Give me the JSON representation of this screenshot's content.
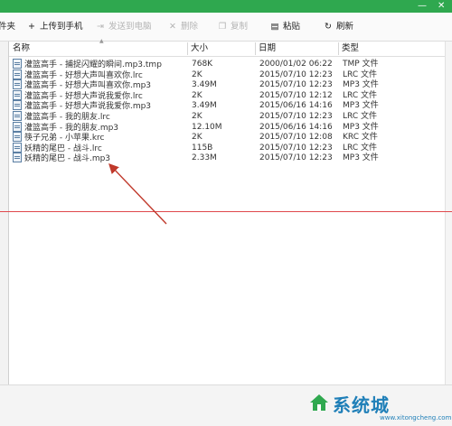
{
  "toolbar": {
    "items": [
      {
        "label": "件夹",
        "icon": "folder-icon",
        "enabled": true
      },
      {
        "label": "上传到手机",
        "icon": "plus-icon",
        "enabled": true
      },
      {
        "label": "发送到电脑",
        "icon": "send-to-pc-icon",
        "enabled": false
      },
      {
        "label": "删除",
        "icon": "delete-icon",
        "enabled": false
      },
      {
        "label": "复制",
        "icon": "copy-icon",
        "enabled": false
      },
      {
        "label": "粘贴",
        "icon": "paste-icon",
        "enabled": true
      },
      {
        "label": "刷新",
        "icon": "refresh-icon",
        "enabled": true
      }
    ]
  },
  "window_controls": {
    "minimize": "—",
    "close": "✕"
  },
  "table": {
    "columns": [
      "名称",
      "大小",
      "日期",
      "类型"
    ],
    "rows": [
      {
        "name": "灌篮高手 - 捕捉闪耀的瞬间.mp3.tmp",
        "size": "768K",
        "date": "2000/01/02 06:22",
        "type": "TMP 文件"
      },
      {
        "name": "灌篮高手 - 好想大声叫喜欢你.lrc",
        "size": "2K",
        "date": "2015/07/10 12:23",
        "type": "LRC 文件"
      },
      {
        "name": "灌篮高手 - 好想大声叫喜欢你.mp3",
        "size": "3.49M",
        "date": "2015/07/10 12:23",
        "type": "MP3 文件"
      },
      {
        "name": "灌篮高手 - 好想大声说我爱你.lrc",
        "size": "2K",
        "date": "2015/07/10 12:12",
        "type": "LRC 文件"
      },
      {
        "name": "灌篮高手 - 好想大声说我爱你.mp3",
        "size": "3.49M",
        "date": "2015/06/16 14:16",
        "type": "MP3 文件"
      },
      {
        "name": "灌篮高手 - 我的朋友.lrc",
        "size": "2K",
        "date": "2015/07/10 12:23",
        "type": "LRC 文件"
      },
      {
        "name": "灌篮高手 - 我的朋友.mp3",
        "size": "12.10M",
        "date": "2015/06/16 14:16",
        "type": "MP3 文件"
      },
      {
        "name": "筷子兄弟 - 小苹果.krc",
        "size": "2K",
        "date": "2015/07/10 12:08",
        "type": "KRC 文件"
      },
      {
        "name": "妖精的尾巴 - 战斗.lrc",
        "size": "115B",
        "date": "2015/07/10 12:23",
        "type": "LRC 文件"
      },
      {
        "name": "妖精的尾巴 - 战斗.mp3",
        "size": "2.33M",
        "date": "2015/07/10 12:23",
        "type": "MP3 文件"
      }
    ]
  },
  "watermark": {
    "text": "系统城",
    "url": "www.xitongcheng.com"
  }
}
